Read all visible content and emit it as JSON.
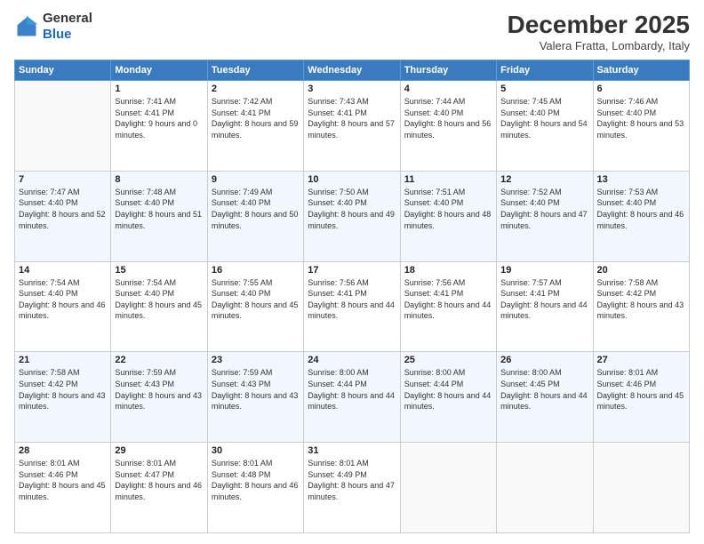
{
  "header": {
    "logo_line1": "General",
    "logo_line2": "Blue",
    "month": "December 2025",
    "location": "Valera Fratta, Lombardy, Italy"
  },
  "days_of_week": [
    "Sunday",
    "Monday",
    "Tuesday",
    "Wednesday",
    "Thursday",
    "Friday",
    "Saturday"
  ],
  "weeks": [
    [
      {
        "day": "",
        "empty": true
      },
      {
        "day": "1",
        "sunrise": "7:41 AM",
        "sunset": "4:41 PM",
        "daylight": "9 hours and 0 minutes."
      },
      {
        "day": "2",
        "sunrise": "7:42 AM",
        "sunset": "4:41 PM",
        "daylight": "8 hours and 59 minutes."
      },
      {
        "day": "3",
        "sunrise": "7:43 AM",
        "sunset": "4:41 PM",
        "daylight": "8 hours and 57 minutes."
      },
      {
        "day": "4",
        "sunrise": "7:44 AM",
        "sunset": "4:40 PM",
        "daylight": "8 hours and 56 minutes."
      },
      {
        "day": "5",
        "sunrise": "7:45 AM",
        "sunset": "4:40 PM",
        "daylight": "8 hours and 54 minutes."
      },
      {
        "day": "6",
        "sunrise": "7:46 AM",
        "sunset": "4:40 PM",
        "daylight": "8 hours and 53 minutes."
      }
    ],
    [
      {
        "day": "7",
        "sunrise": "7:47 AM",
        "sunset": "4:40 PM",
        "daylight": "8 hours and 52 minutes."
      },
      {
        "day": "8",
        "sunrise": "7:48 AM",
        "sunset": "4:40 PM",
        "daylight": "8 hours and 51 minutes."
      },
      {
        "day": "9",
        "sunrise": "7:49 AM",
        "sunset": "4:40 PM",
        "daylight": "8 hours and 50 minutes."
      },
      {
        "day": "10",
        "sunrise": "7:50 AM",
        "sunset": "4:40 PM",
        "daylight": "8 hours and 49 minutes."
      },
      {
        "day": "11",
        "sunrise": "7:51 AM",
        "sunset": "4:40 PM",
        "daylight": "8 hours and 48 minutes."
      },
      {
        "day": "12",
        "sunrise": "7:52 AM",
        "sunset": "4:40 PM",
        "daylight": "8 hours and 47 minutes."
      },
      {
        "day": "13",
        "sunrise": "7:53 AM",
        "sunset": "4:40 PM",
        "daylight": "8 hours and 46 minutes."
      }
    ],
    [
      {
        "day": "14",
        "sunrise": "7:54 AM",
        "sunset": "4:40 PM",
        "daylight": "8 hours and 46 minutes."
      },
      {
        "day": "15",
        "sunrise": "7:54 AM",
        "sunset": "4:40 PM",
        "daylight": "8 hours and 45 minutes."
      },
      {
        "day": "16",
        "sunrise": "7:55 AM",
        "sunset": "4:40 PM",
        "daylight": "8 hours and 45 minutes."
      },
      {
        "day": "17",
        "sunrise": "7:56 AM",
        "sunset": "4:41 PM",
        "daylight": "8 hours and 44 minutes."
      },
      {
        "day": "18",
        "sunrise": "7:56 AM",
        "sunset": "4:41 PM",
        "daylight": "8 hours and 44 minutes."
      },
      {
        "day": "19",
        "sunrise": "7:57 AM",
        "sunset": "4:41 PM",
        "daylight": "8 hours and 44 minutes."
      },
      {
        "day": "20",
        "sunrise": "7:58 AM",
        "sunset": "4:42 PM",
        "daylight": "8 hours and 43 minutes."
      }
    ],
    [
      {
        "day": "21",
        "sunrise": "7:58 AM",
        "sunset": "4:42 PM",
        "daylight": "8 hours and 43 minutes."
      },
      {
        "day": "22",
        "sunrise": "7:59 AM",
        "sunset": "4:43 PM",
        "daylight": "8 hours and 43 minutes."
      },
      {
        "day": "23",
        "sunrise": "7:59 AM",
        "sunset": "4:43 PM",
        "daylight": "8 hours and 43 minutes."
      },
      {
        "day": "24",
        "sunrise": "8:00 AM",
        "sunset": "4:44 PM",
        "daylight": "8 hours and 44 minutes."
      },
      {
        "day": "25",
        "sunrise": "8:00 AM",
        "sunset": "4:44 PM",
        "daylight": "8 hours and 44 minutes."
      },
      {
        "day": "26",
        "sunrise": "8:00 AM",
        "sunset": "4:45 PM",
        "daylight": "8 hours and 44 minutes."
      },
      {
        "day": "27",
        "sunrise": "8:01 AM",
        "sunset": "4:46 PM",
        "daylight": "8 hours and 45 minutes."
      }
    ],
    [
      {
        "day": "28",
        "sunrise": "8:01 AM",
        "sunset": "4:46 PM",
        "daylight": "8 hours and 45 minutes."
      },
      {
        "day": "29",
        "sunrise": "8:01 AM",
        "sunset": "4:47 PM",
        "daylight": "8 hours and 46 minutes."
      },
      {
        "day": "30",
        "sunrise": "8:01 AM",
        "sunset": "4:48 PM",
        "daylight": "8 hours and 46 minutes."
      },
      {
        "day": "31",
        "sunrise": "8:01 AM",
        "sunset": "4:49 PM",
        "daylight": "8 hours and 47 minutes."
      },
      {
        "day": "",
        "empty": true
      },
      {
        "day": "",
        "empty": true
      },
      {
        "day": "",
        "empty": true
      }
    ]
  ],
  "labels": {
    "sunrise": "Sunrise:",
    "sunset": "Sunset:",
    "daylight": "Daylight:"
  }
}
